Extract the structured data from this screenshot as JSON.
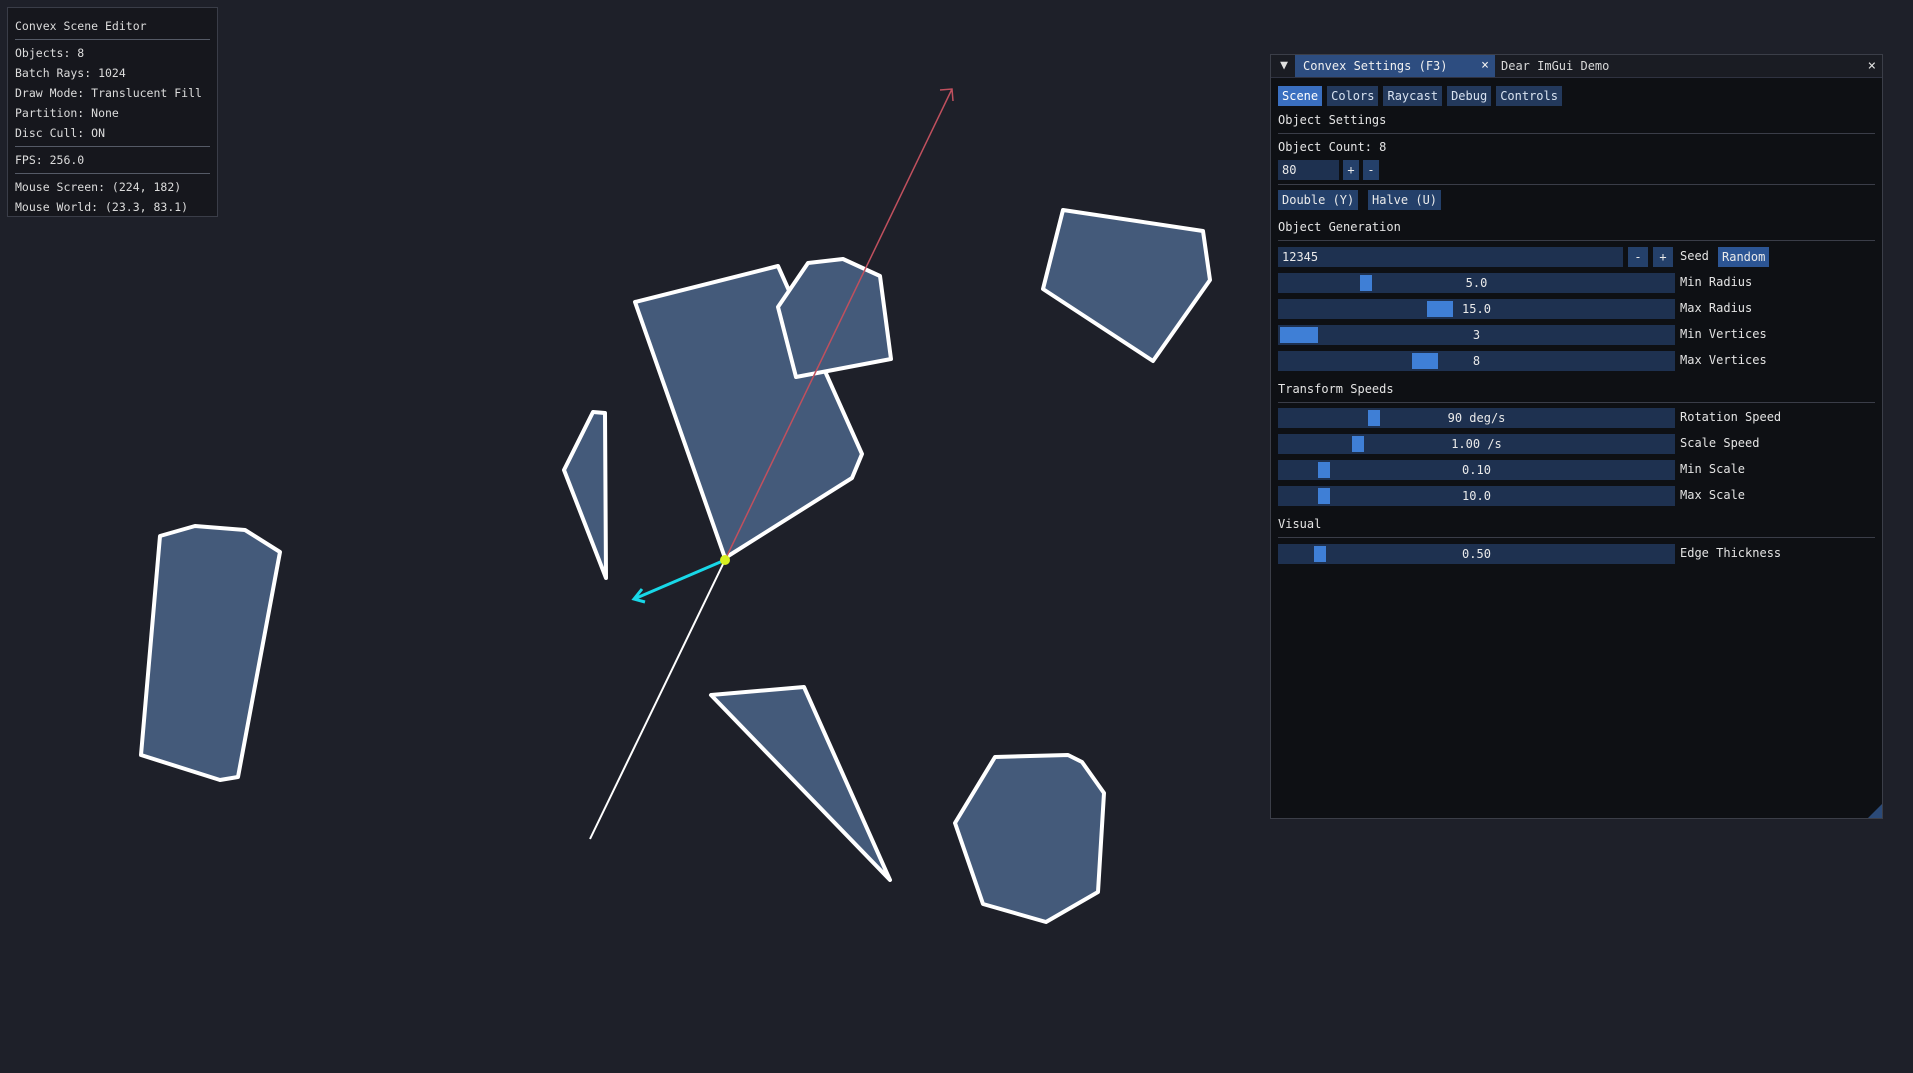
{
  "info": {
    "title": "Convex Scene Editor",
    "objects": "Objects: 8",
    "batch_rays": "Batch Rays: 1024",
    "draw_mode": "Draw Mode: Translucent Fill",
    "partition": "Partition: None",
    "disc_cull": "Disc Cull: ON",
    "fps": "FPS: 256.0",
    "mouse_screen": "Mouse Screen: (224, 182)",
    "mouse_world": "Mouse World: (23.3, 83.1)"
  },
  "panel": {
    "tab_active": "Convex Settings (F3)",
    "tab_close": "×",
    "tab_other": "Dear ImGui Demo",
    "window_close": "×",
    "collapse_icon": "▼",
    "subtabs": [
      "Scene",
      "Colors",
      "Raycast",
      "Debug",
      "Controls"
    ],
    "object_settings": {
      "header": "Object Settings",
      "count_label": "Object Count: 8",
      "count_value": "80",
      "plus": "+",
      "minus": "-",
      "double_btn": "Double (Y)",
      "halve_btn": "Halve (U)"
    },
    "object_generation": {
      "header": "Object Generation",
      "seed_value": "12345",
      "seed_minus": "-",
      "seed_plus": "+",
      "seed_label": "Seed",
      "random_btn": "Random",
      "sliders": [
        {
          "value": "5.0",
          "label": "Min Radius",
          "fraction": 0.21
        },
        {
          "value": "15.0",
          "label": "Max Radius",
          "fraction": 0.4
        },
        {
          "value": "3",
          "label": "Min Vertices",
          "fraction": 0.0
        },
        {
          "value": "8",
          "label": "Max Vertices",
          "fraction": 0.36
        }
      ]
    },
    "transform_speeds": {
      "header": "Transform Speeds",
      "sliders": [
        {
          "value": "90 deg/s",
          "label": "Rotation Speed",
          "fraction": 0.23
        },
        {
          "value": "1.00 /s",
          "label": "Scale Speed",
          "fraction": 0.19
        },
        {
          "value": "0.10",
          "label": "Min Scale",
          "fraction": 0.1
        },
        {
          "value": "10.0",
          "label": "Max Scale",
          "fraction": 0.1
        }
      ]
    },
    "visual": {
      "header": "Visual",
      "sliders": [
        {
          "value": "0.50",
          "label": "Edge Thickness",
          "fraction": 0.09
        }
      ]
    }
  },
  "colors": {
    "background": "#1e2029",
    "shape_fill": "#445a7a",
    "shape_edge": "#ffffff",
    "ray_primary": "#c0505e",
    "ray_reflect": "#18d8e8",
    "hit_point": "#d8f020",
    "accent": "#3f7fd6"
  }
}
